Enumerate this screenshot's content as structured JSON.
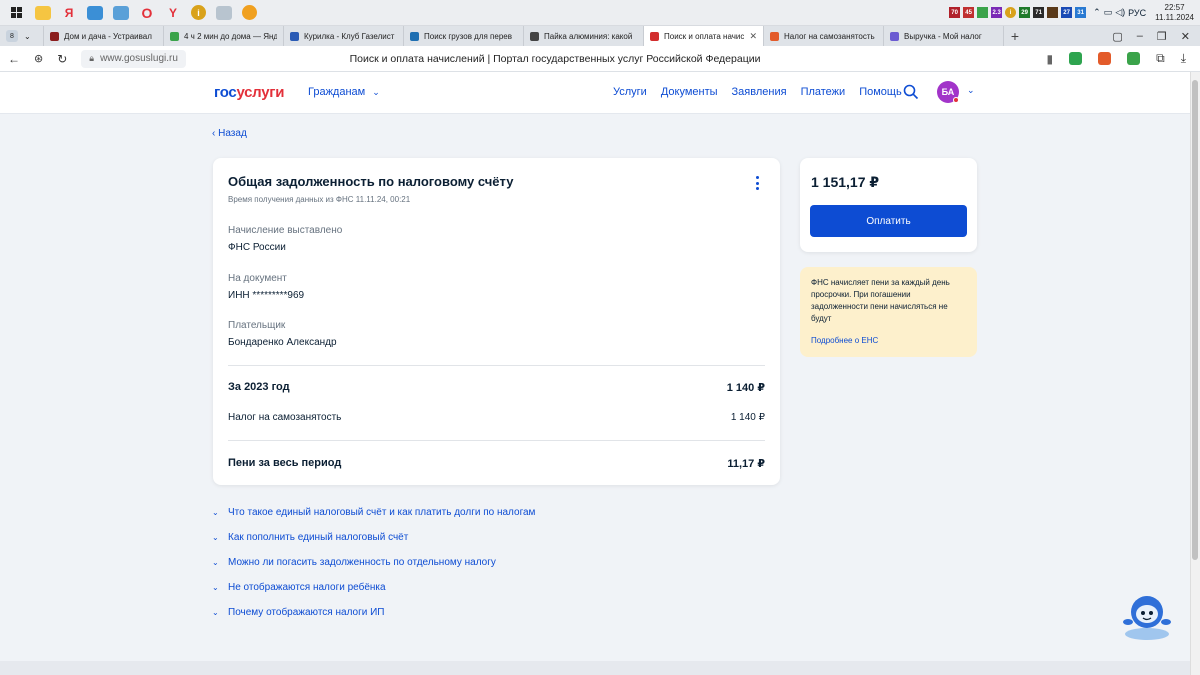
{
  "os": {
    "clock_time": "22:57",
    "clock_date": "11.11.2024",
    "lang": "РУС",
    "tray_numbers": [
      "70",
      "45",
      "2.3",
      "29",
      "71",
      "27",
      "31"
    ]
  },
  "browser": {
    "tabs": [
      {
        "label": "Дом и дача - Устраивал",
        "color": "#8b1d1d"
      },
      {
        "label": "4 ч 2 мин до дома — Янд",
        "color": "#3aa34a"
      },
      {
        "label": "Курилка - Клуб Газелист",
        "color": "#2a5bb5"
      },
      {
        "label": "Поиск грузов для перев",
        "color": "#1f6fb2"
      },
      {
        "label": "Пайка алюминия: какой",
        "color": "#444444"
      },
      {
        "label": "Поиск и оплата начис",
        "color": "#d22e2e",
        "active": true
      },
      {
        "label": "Налог на самозанятость",
        "color": "#e35b2a"
      },
      {
        "label": "Выручка - Мой налог",
        "color": "#6b5bd2"
      }
    ],
    "url": "www.gosuslugi.ru",
    "page_title": "Поиск и оплата начислений | Портал государственных услуг Российской Федерации"
  },
  "header": {
    "logo_a": "гос",
    "logo_b": "услуги",
    "role": "Гражданам",
    "nav": [
      "Услуги",
      "Документы",
      "Заявления",
      "Платежи",
      "Помощь"
    ],
    "avatar_initials": "БА"
  },
  "back_label": "Назад",
  "debt": {
    "title": "Общая задолженность по налоговому счёту",
    "subtitle": "Время получения данных из ФНС 11.11.24, 00:21",
    "issued_label": "Начисление выставлено",
    "issued_value": "ФНС России",
    "document_label": "На документ",
    "document_value": "ИНН *********969",
    "payer_label": "Плательщик",
    "payer_value": "Бондаренко Александр",
    "year_label": "За 2023 год",
    "year_amount": "1 140 ₽",
    "tax_label": "Налог на самозанятость",
    "tax_amount": "1 140 ₽",
    "penalty_label": "Пени за весь период",
    "penalty_amount": "11,17 ₽"
  },
  "payment": {
    "amount": "1 151,17 ₽",
    "button": "Оплатить"
  },
  "info": {
    "text": "ФНС начисляет пени за каждый день просрочки. При погашении задолженности пени начисляться не будут",
    "link": "Подробнее о ЕНС"
  },
  "faq": [
    "Что такое единый налоговый счёт и как платить долги по налогам",
    "Как пополнить единый налоговый счёт",
    "Можно ли погасить задолженность по отдельному налогу",
    "Не отображаются налоги ребёнка",
    "Почему отображаются налоги ИП"
  ]
}
